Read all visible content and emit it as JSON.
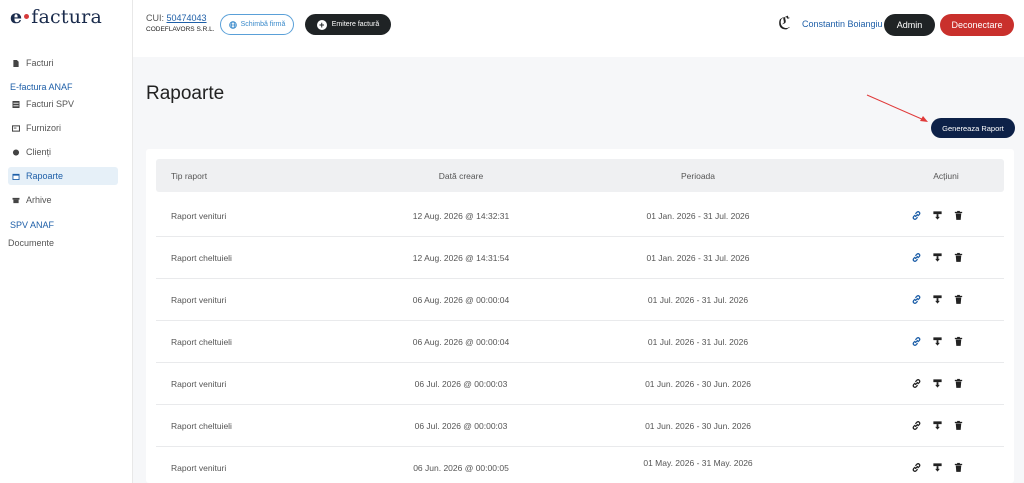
{
  "brand": {
    "e": "e",
    "name": "factura"
  },
  "sidebar": {
    "facturi": "Facturi",
    "section_efactura": "E-factura ANAF",
    "items": [
      {
        "label": "Facturi SPV"
      },
      {
        "label": "Furnizori"
      },
      {
        "label": "Clienți"
      },
      {
        "label": "Rapoarte"
      },
      {
        "label": "Arhive"
      }
    ],
    "section_spv": "SPV ANAF",
    "documente": "Documente"
  },
  "header": {
    "cui_label": "CUI:",
    "cui_value": "50474043",
    "company": "CODEFLAVORS S.R.L.",
    "change_company": "Schimbă firmă",
    "issue_invoice": "Emitere factură",
    "user_name": "Constantin Boiangiu",
    "admin": "Admin",
    "logout": "Deconectare"
  },
  "main": {
    "title": "Rapoarte",
    "generate_button": "Genereaza Raport",
    "columns": [
      "Tip raport",
      "Dată creare",
      "Perioada",
      "Acțiuni"
    ],
    "rows": [
      {
        "type": "Raport venituri",
        "created": "12 Aug. 2026 @ 14:32:31",
        "period": "01 Jan. 2026 - 31 Jul. 2026",
        "link_color": "#1e5fa8"
      },
      {
        "type": "Raport cheltuieli",
        "created": "12 Aug. 2026 @ 14:31:54",
        "period": "01 Jan. 2026 - 31 Jul. 2026",
        "link_color": "#1e5fa8"
      },
      {
        "type": "Raport venituri",
        "created": "06 Aug. 2026 @ 00:00:04",
        "period": "01 Jul. 2026 - 31 Jul. 2026",
        "link_color": "#1e5fa8"
      },
      {
        "type": "Raport cheltuieli",
        "created": "06 Aug. 2026 @ 00:00:04",
        "period": "01 Jul. 2026 - 31 Jul. 2026",
        "link_color": "#1e5fa8"
      },
      {
        "type": "Raport venituri",
        "created": "06 Jul. 2026 @ 00:00:03",
        "period": "01 Jun. 2026 - 30 Jun. 2026",
        "link_color": "#222222"
      },
      {
        "type": "Raport cheltuieli",
        "created": "06 Jul. 2026 @ 00:00:03",
        "period": "01 Jun. 2026 - 30 Jun. 2026",
        "link_color": "#222222"
      },
      {
        "type": "Raport venituri",
        "created": "06 Jun. 2026 @ 00:00:05",
        "period": "01 May. 2026 - 31 May. 2026",
        "link_color": "#222222"
      }
    ]
  },
  "colors": {
    "accent": "#1e5fa8",
    "danger": "#c9302c",
    "dark": "#1f2325",
    "navy": "#0d2148"
  }
}
